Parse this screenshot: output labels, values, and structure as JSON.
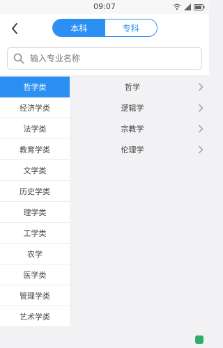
{
  "status_bar": {
    "time": "09:07",
    "icons": [
      "wifi-icon",
      "signal-icon",
      "battery-icon"
    ]
  },
  "header": {
    "back_icon": "chevron-left-icon",
    "tabs": [
      {
        "label": "本科",
        "active": true
      },
      {
        "label": "专科",
        "active": false
      }
    ]
  },
  "search": {
    "placeholder": "输入专业名称",
    "value": "",
    "icon": "search-icon"
  },
  "categories": [
    {
      "label": "哲学类",
      "selected": true
    },
    {
      "label": "经济学类",
      "selected": false
    },
    {
      "label": "法学类",
      "selected": false
    },
    {
      "label": "教育学类",
      "selected": false
    },
    {
      "label": "文学类",
      "selected": false
    },
    {
      "label": "历史学类",
      "selected": false
    },
    {
      "label": "理学类",
      "selected": false
    },
    {
      "label": "工学类",
      "selected": false
    },
    {
      "label": "农学",
      "selected": false
    },
    {
      "label": "医学类",
      "selected": false
    },
    {
      "label": "管理学类",
      "selected": false
    },
    {
      "label": "艺术学类",
      "selected": false
    }
  ],
  "subcategories": [
    {
      "label": "哲学"
    },
    {
      "label": "逻辑学"
    },
    {
      "label": "宗教学"
    },
    {
      "label": "伦理学"
    }
  ],
  "colors": {
    "accent": "#2c8ff4",
    "background": "#f2f2f4",
    "watermark": "#2fae6a"
  }
}
